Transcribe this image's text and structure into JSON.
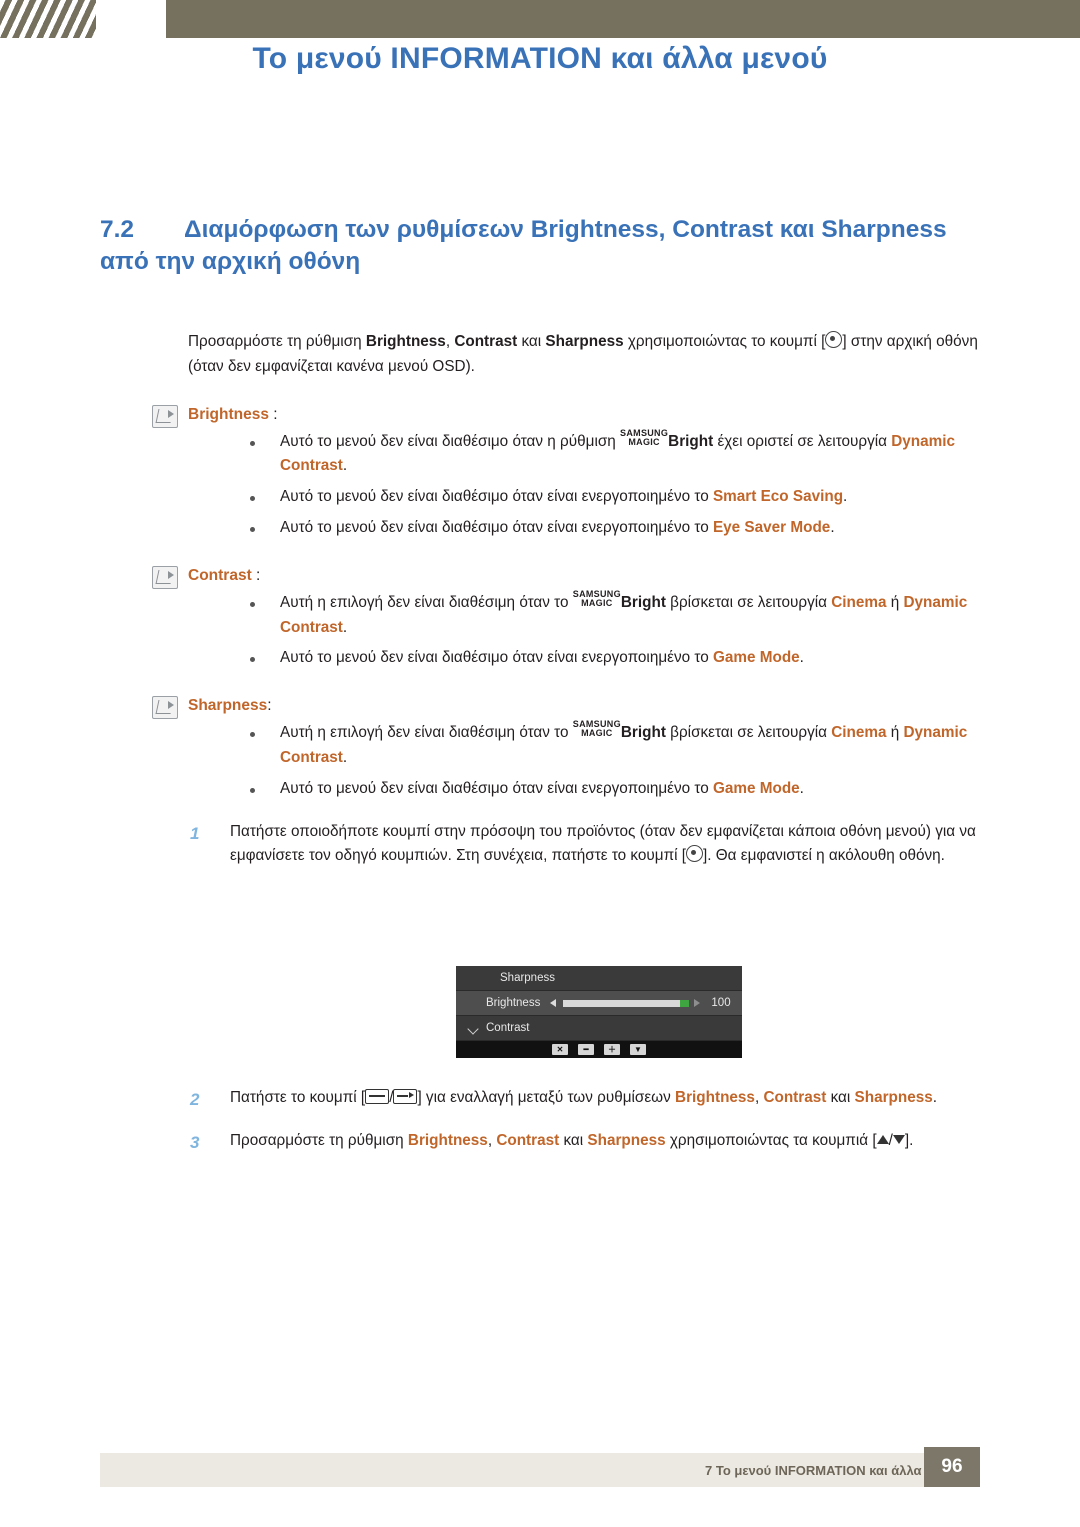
{
  "header": {
    "title": "Το μενού INFORMATION και άλλα μενού"
  },
  "section": {
    "number": "7.2",
    "title": "Διαμόρφωση των ρυθμίσεων Brightness, Contrast και Sharpness από την αρχική οθόνη"
  },
  "intro": {
    "p1_a": "Προσαρμόστε τη ρύθμιση ",
    "p1_b": "Brightness",
    "p1_c": ", ",
    "p1_d": "Contrast",
    "p1_e": " και ",
    "p1_f": "Sharpness",
    "p1_g": " χρησιμοποιώντας το κουμπί [",
    "p1_h": "] στην αρχική οθόνη (όταν δεν εμφανίζεται κανένα μενού OSD)."
  },
  "notes": [
    {
      "title": "Brightness",
      "colon": " :",
      "bullets": [
        {
          "pre": "Αυτό το μενού δεν είναι διαθέσιμο όταν η ρύθμιση ",
          "magic_top": "SAMSUNG",
          "magic_bottom": "MAGIC",
          "bright": "Bright",
          "mid": " έχει οριστεί σε λειτουργία ",
          "term": "Dynamic Contrast",
          "post": "."
        },
        {
          "pre": "Αυτό το μενού δεν είναι διαθέσιμο όταν είναι ενεργοποιημένο το ",
          "term": "Smart Eco Saving",
          "post": "."
        },
        {
          "pre": "Αυτό το μενού δεν είναι διαθέσιμο όταν είναι ενεργοποιημένο το ",
          "term": "Eye Saver Mode",
          "post": "."
        }
      ]
    },
    {
      "title": "Contrast",
      "colon": " :",
      "bullets": [
        {
          "pre": "Αυτή η επιλογή δεν είναι διαθέσιμη όταν το ",
          "magic_top": "SAMSUNG",
          "magic_bottom": "MAGIC",
          "bright": "Bright",
          "mid": " βρίσκεται σε λειτουργία ",
          "term1": "Cinema",
          "mid2": " ή ",
          "term": "Dynamic Contrast",
          "post": "."
        },
        {
          "pre": "Αυτό το μενού δεν είναι διαθέσιμο όταν είναι ενεργοποιημένο το ",
          "term": "Game Mode",
          "post": "."
        }
      ]
    },
    {
      "title": "Sharpness",
      "colon": ":",
      "bullets": [
        {
          "pre": "Αυτή η επιλογή δεν είναι διαθέσιμη όταν το ",
          "magic_top": "SAMSUNG",
          "magic_bottom": "MAGIC",
          "bright": "Bright",
          "mid": " βρίσκεται σε λειτουργία ",
          "term1": "Cinema",
          "mid2": " ή ",
          "term": "Dynamic Contrast",
          "post": "."
        },
        {
          "pre": "Αυτό το μενού δεν είναι διαθέσιμο όταν είναι ενεργοποιημένο το ",
          "term": "Game Mode",
          "post": "."
        }
      ]
    }
  ],
  "steps": {
    "s1_num": "1",
    "s1_a": "Πατήστε οποιοδήποτε κουμπί στην πρόσοψη του προϊόντος (όταν δεν εμφανίζεται κάποια οθόνη μενού) για να εμφανίσετε τον οδηγό κουμπιών. Στη συνέχεια, πατήστε το κουμπί [",
    "s1_b": "]. Θα εμφανιστεί η ακόλουθη οθόνη.",
    "s2_num": "2",
    "s2_a": "Πατήστε το κουμπί [",
    "s2_b": "/",
    "s2_c": "] για εναλλαγή μεταξύ των ρυθμίσεων ",
    "s2_d": "Brightness",
    "s2_e": ", ",
    "s2_f": "Contrast",
    "s2_g": " και ",
    "s2_h": "Sharpness",
    "s2_i": ".",
    "s3_num": "3",
    "s3_a": "Προσαρμόστε τη ρύθμιση ",
    "s3_b": "Brightness",
    "s3_c": ", ",
    "s3_d": "Contrast",
    "s3_e": " και ",
    "s3_f": "Sharpness",
    "s3_g": " χρησιμοποιώντας τα κουμπιά [",
    "s3_h": "/",
    "s3_i": "]."
  },
  "osd": {
    "top_label": "Sharpness",
    "mid_label": "Brightness",
    "mid_value": "100",
    "bottom_label": "Contrast",
    "keys": [
      "✕",
      "━",
      "＋",
      "▼"
    ]
  },
  "footer": {
    "text": "7 Το μενού INFORMATION και άλλα μενού",
    "page": "96"
  },
  "colors": {
    "accent_blue": "#3a72b8",
    "accent_orange": "#c1662a",
    "header_band": "#76705e",
    "footer_band": "#ece9e2"
  }
}
